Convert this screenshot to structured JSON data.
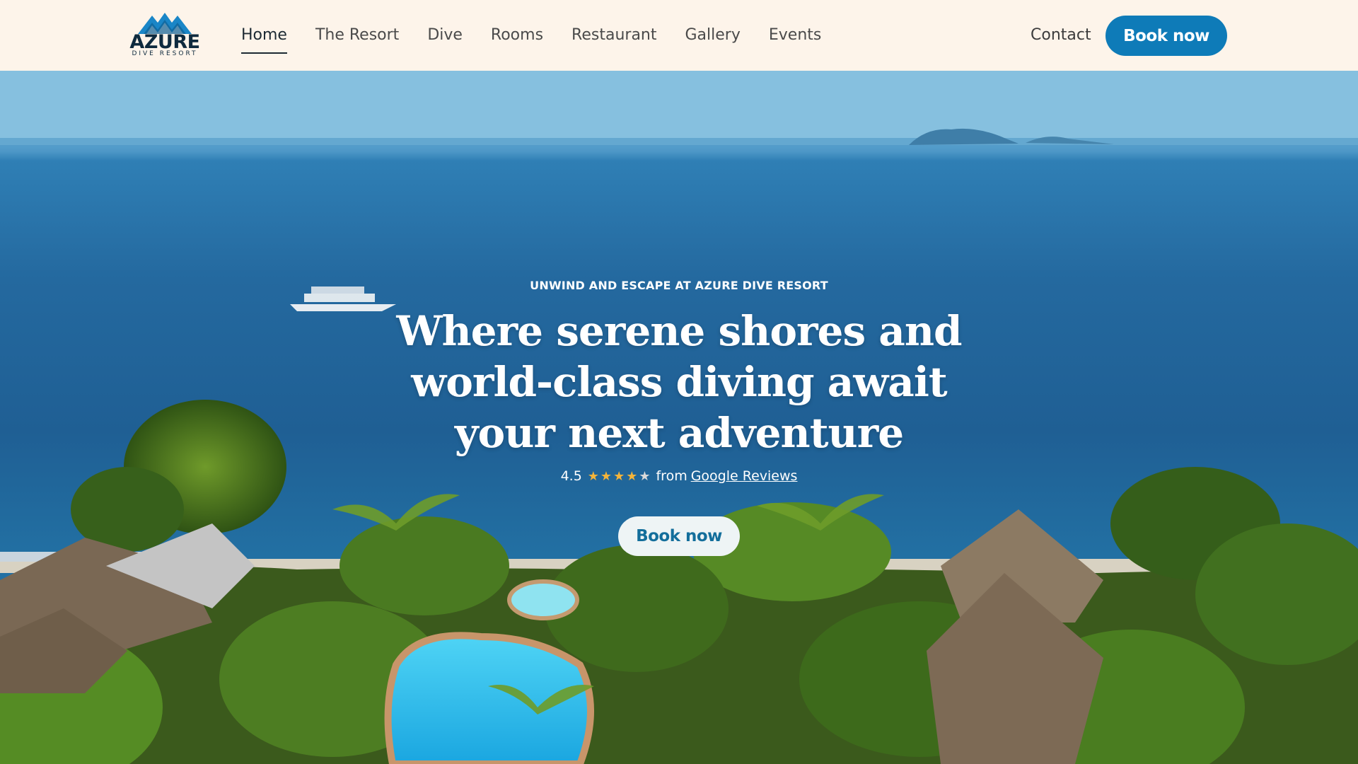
{
  "brand": {
    "name": "AZURE",
    "tagline": "DIVE RESORT"
  },
  "nav": {
    "items": [
      {
        "label": "Home",
        "active": true
      },
      {
        "label": "The Resort"
      },
      {
        "label": "Dive"
      },
      {
        "label": "Rooms"
      },
      {
        "label": "Restaurant"
      },
      {
        "label": "Gallery"
      },
      {
        "label": "Events"
      }
    ],
    "contact_label": "Contact",
    "book_label": "Book now"
  },
  "hero": {
    "eyebrow": "UNWIND AND ESCAPE AT AZURE DIVE RESORT",
    "headline_line1": "Where serene shores and",
    "headline_line2": "world-class diving await",
    "headline_line3": "your next adventure",
    "rating_value": "4.5",
    "rating_stars": 4.5,
    "rating_from": "from",
    "rating_source": "Google Reviews",
    "book_label": "Book now"
  },
  "colors": {
    "primary": "#0e7bb8",
    "header_bg": "#fdf4ea",
    "star": "#f4b43a"
  }
}
